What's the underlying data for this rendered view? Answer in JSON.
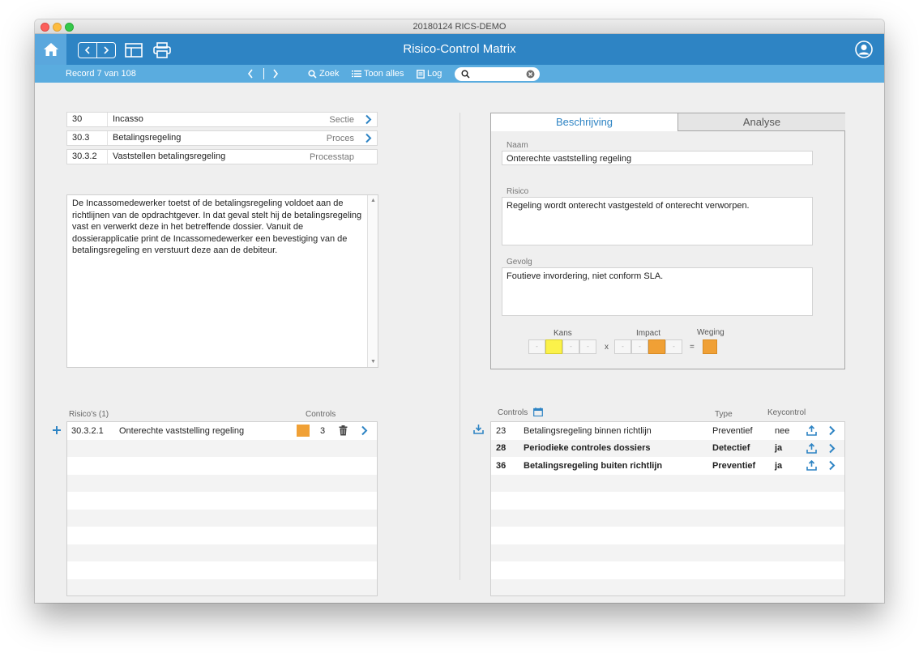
{
  "window": {
    "title": "20180124 RICS-DEMO"
  },
  "header": {
    "title": "Risico-Control Matrix",
    "home_icon": "home-icon",
    "user_icon": "user-icon",
    "accent": "#2e84c4",
    "home_bg": "#5aa7dd"
  },
  "toolbar": {
    "record_text": "Record 7 van 108",
    "find_label": "Zoek",
    "show_all_label": "Toon alles",
    "log_label": "Log",
    "search_value": "",
    "bg": "#5aacdf"
  },
  "breadcrumbs": [
    {
      "code": "30",
      "name": "Incasso",
      "kind": "Sectie",
      "has_link": true
    },
    {
      "code": "30.3",
      "name": "Betalingsregeling",
      "kind": "Proces",
      "has_link": true
    },
    {
      "code": "30.3.2",
      "name": "Vaststellen betalingsregeling",
      "kind": "Processtap",
      "has_link": false
    }
  ],
  "description": "De Incassomedewerker toetst of de betalingsregeling voldoet aan de richtlijnen van de opdrachtgever. In dat geval stelt hij de betalingsregeling vast en verwerkt deze in het betreffende dossier. Vanuit de dossierapplicatie print de Incassomedewerker een bevestiging van de betalingsregeling en verstuurt deze aan de debiteur.",
  "risks": {
    "label": "Risico's (1)",
    "controls_header": "Controls",
    "rows": [
      {
        "code": "30.3.2.1",
        "name": "Onterechte vaststelling regeling",
        "weight_color": "#f0a035",
        "controls": "3"
      }
    ]
  },
  "tabs": [
    {
      "label": "Beschrijving",
      "active": true
    },
    {
      "label": "Analyse",
      "active": false
    }
  ],
  "detail": {
    "name_label": "Naam",
    "name_value": "Onterechte vaststelling regeling",
    "risk_label": "Risico",
    "risk_value": "Regeling wordt onterecht vastgesteld of onterecht verworpen.",
    "effect_label": "Gevolg",
    "effect_value": "Foutieve invordering, niet conform SLA.",
    "kans_label": "Kans",
    "impact_label": "Impact",
    "weging_label": "Weging",
    "times_sign": "x",
    "equals_sign": "=",
    "kans_selected_index": 1,
    "impact_selected_index": 2,
    "kans_color": "#fbf24a",
    "impact_color": "#f0a035",
    "weging_color": "#f0a035"
  },
  "controls": {
    "label": "Controls",
    "type_header": "Type",
    "key_header": "Keycontrol",
    "rows": [
      {
        "num": "23",
        "name": "Betalingsregeling binnen richtlijn",
        "type": "Preventief",
        "key": "nee",
        "bold": false
      },
      {
        "num": "28",
        "name": "Periodieke controles dossiers",
        "type": "Detectief",
        "key": "ja",
        "bold": true
      },
      {
        "num": "36",
        "name": "Betalingsregeling buiten richtlijn",
        "type": "Preventief",
        "key": "ja",
        "bold": true
      }
    ]
  }
}
